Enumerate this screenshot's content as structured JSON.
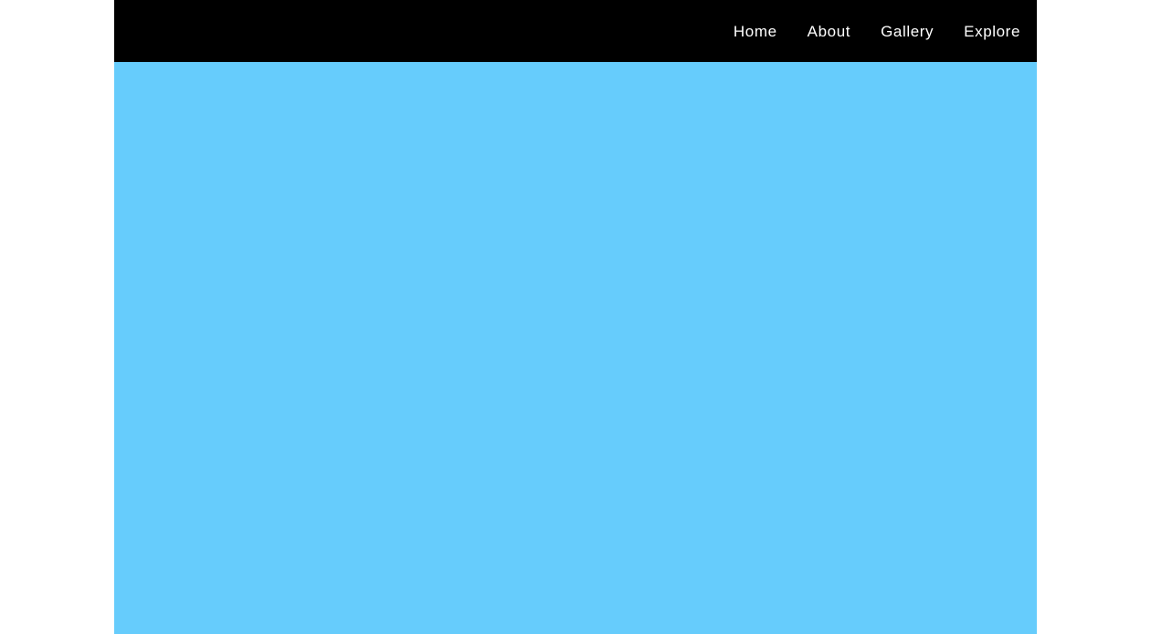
{
  "theme": {
    "page_bg": "#ffffff",
    "header_bg": "#000000",
    "hero_bg": "#66ccfc",
    "nav_text_color": "#ffffff"
  },
  "nav": {
    "items": [
      {
        "label": "Home"
      },
      {
        "label": "About"
      },
      {
        "label": "Gallery"
      },
      {
        "label": "Explore"
      }
    ]
  },
  "hero": {
    "content": ""
  }
}
